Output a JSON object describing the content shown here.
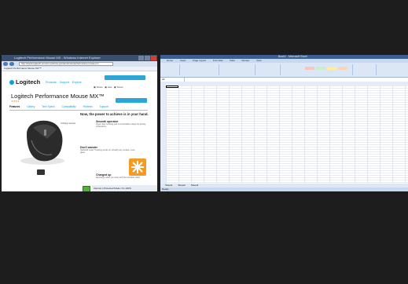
{
  "browser": {
    "title": "Logitech Performance Mouse MX - Windows Internet Explorer",
    "address": "http://www.logitech.com/en-us/mice-pointers/mice/performance-mouse-mx",
    "favorites": "Logitech Performance Mouse MX™",
    "logo": "Logitech",
    "nav": [
      "Products",
      "Support",
      "Explore"
    ],
    "product_title": "Logitech Performance Mouse MX™",
    "rating": "★★★★",
    "tabs": [
      "Features",
      "Gallery",
      "Tech Specs",
      "Compatibility",
      "Reviews",
      "Support"
    ],
    "headline": "Now, the power to achieve is in your hand.",
    "features": [
      {
        "title": "Smooth operator",
        "body": "Hyper-fast scrolling and a comfortable shape for all-day productivity."
      },
      {
        "title": "Don't wander",
        "body": "Darkfield Laser Tracking works on virtually any surface, even glass."
      },
      {
        "title": "Charged up",
        "body": "Recharge while you work with the included cable."
      }
    ],
    "pointer_label": "Unifying receiver",
    "status": "Internet | Protected Mode: On   100%"
  },
  "excel": {
    "title": "Book1 - Microsoft Excel",
    "tabs": [
      "Home",
      "Insert",
      "Page Layout",
      "Formulas",
      "Data",
      "Review",
      "View"
    ],
    "name_box": "A1",
    "sheet_tabs": [
      "Sheet1",
      "Sheet2",
      "Sheet3"
    ],
    "status": "Ready",
    "style_colors": [
      "#f4c7c3",
      "#c6efce",
      "#ffeb9c",
      "#dce6f1",
      "#fcd5b4",
      "#e4dfec"
    ]
  }
}
